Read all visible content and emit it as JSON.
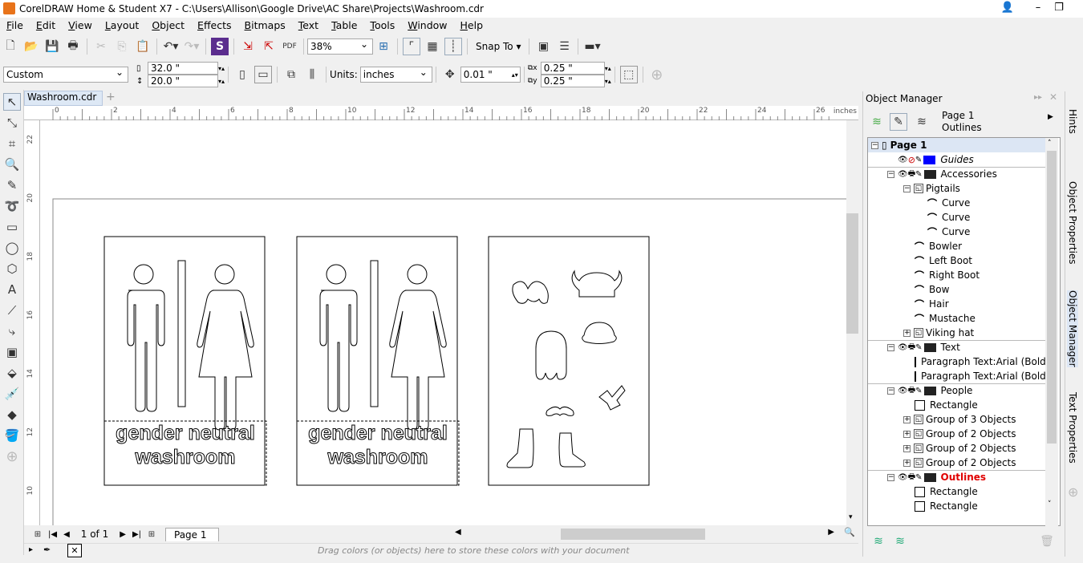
{
  "window": {
    "title": "CorelDRAW Home & Student X7 - C:\\Users\\Allison\\Google Drive\\AC Share\\Projects\\Washroom.cdr"
  },
  "menu": [
    "File",
    "Edit",
    "View",
    "Layout",
    "Object",
    "Effects",
    "Bitmaps",
    "Text",
    "Table",
    "Tools",
    "Window",
    "Help"
  ],
  "toolbar": {
    "zoom": "38%",
    "snap_to": "Snap To"
  },
  "propbar": {
    "preset": "Custom",
    "width": "32.0 \"",
    "height": "20.0 \"",
    "units_label": "Units:",
    "units": "inches",
    "nudge": "0.01 \"",
    "dup_x": "0.25 \"",
    "dup_y": "0.25 \""
  },
  "document": {
    "tab": "Washroom.cdr",
    "ruler_unit": "inches",
    "h_ticks": [
      "0",
      "2",
      "4",
      "6",
      "8",
      "10",
      "12",
      "14",
      "16",
      "18",
      "20",
      "22",
      "24",
      "26"
    ],
    "v_ticks": [
      "22",
      "20",
      "18",
      "16",
      "14",
      "12",
      "10"
    ],
    "sign_text": [
      "gender neutral",
      "washroom"
    ]
  },
  "nav": {
    "page_count": "1 of 1",
    "page_tab": "Page 1"
  },
  "colorbar": {
    "hint": "Drag colors (or objects) here to store these colors with your document"
  },
  "object_manager": {
    "title": "Object Manager",
    "page": "Page 1",
    "layer": "Outlines",
    "tree": [
      {
        "label": "Page 1",
        "level": 0,
        "type": "page",
        "expander": "−"
      },
      {
        "label": "Guides",
        "level": 1,
        "type": "layer",
        "color": "#0000ff",
        "italic": true,
        "noprint": true
      },
      {
        "label": "Accessories",
        "level": 1,
        "type": "layer",
        "color": "#222222",
        "expander": "−"
      },
      {
        "label": "Pigtails",
        "level": 2,
        "type": "group",
        "expander": "−"
      },
      {
        "label": "Curve",
        "level": 3,
        "type": "curve"
      },
      {
        "label": "Curve",
        "level": 3,
        "type": "curve"
      },
      {
        "label": "Curve",
        "level": 3,
        "type": "curve"
      },
      {
        "label": "Bowler",
        "level": 2,
        "type": "curve"
      },
      {
        "label": "Left Boot",
        "level": 2,
        "type": "curve"
      },
      {
        "label": "Right Boot",
        "level": 2,
        "type": "curve"
      },
      {
        "label": "Bow",
        "level": 2,
        "type": "curve"
      },
      {
        "label": "Hair",
        "level": 2,
        "type": "curve"
      },
      {
        "label": "Mustache",
        "level": 2,
        "type": "curve"
      },
      {
        "label": "Viking hat",
        "level": 2,
        "type": "group",
        "expander": "+"
      },
      {
        "label": "Text",
        "level": 1,
        "type": "layer",
        "color": "#222222",
        "expander": "−"
      },
      {
        "label": "Paragraph Text:Arial (Bold)",
        "level": 2,
        "type": "rect"
      },
      {
        "label": "Paragraph Text:Arial (Bold)",
        "level": 2,
        "type": "rect"
      },
      {
        "label": "People",
        "level": 1,
        "type": "layer",
        "color": "#222222",
        "expander": "−"
      },
      {
        "label": "Rectangle",
        "level": 2,
        "type": "rect"
      },
      {
        "label": "Group of 3 Objects",
        "level": 2,
        "type": "group",
        "expander": "+"
      },
      {
        "label": "Group of 2 Objects",
        "level": 2,
        "type": "group",
        "expander": "+"
      },
      {
        "label": "Group of 2 Objects",
        "level": 2,
        "type": "group",
        "expander": "+"
      },
      {
        "label": "Group of 2 Objects",
        "level": 2,
        "type": "group",
        "expander": "+"
      },
      {
        "label": "Outlines",
        "level": 1,
        "type": "layer",
        "color": "#222222",
        "expander": "−",
        "active": true
      },
      {
        "label": "Rectangle",
        "level": 2,
        "type": "rect"
      },
      {
        "label": "Rectangle",
        "level": 2,
        "type": "rect"
      }
    ]
  },
  "side_tabs": [
    "Hints",
    "Object Properties",
    "Object Manager",
    "Text Properties"
  ],
  "colors": {
    "active_layer": "#e00000",
    "selection": "#dce6f4"
  }
}
